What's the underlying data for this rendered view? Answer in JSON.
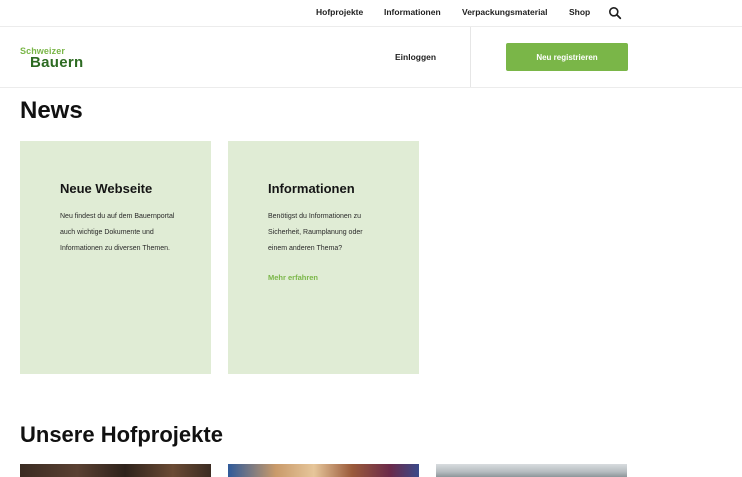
{
  "topnav": {
    "links": [
      "Hofprojekte",
      "Informationen",
      "Verpackungsmaterial",
      "Shop"
    ],
    "search_icon": "search-icon"
  },
  "header": {
    "logo_line1": "Schweizer",
    "logo_line2": "Bauern",
    "login_label": "Einloggen",
    "register_label": "Neu registrieren"
  },
  "news": {
    "heading": "News",
    "cards": [
      {
        "title": "Neue Webseite",
        "body": "Neu findest du auf dem Bauernportal auch wichtige Dokumente und Informationen zu diversen Themen.",
        "link": ""
      },
      {
        "title": "Informationen",
        "body": "Benötigst du Informationen zu Sicherheit, Raumplanung oder einem anderen Thema?",
        "link": "Mehr erfahren"
      }
    ]
  },
  "projects": {
    "heading": "Unsere Hofprojekte"
  },
  "colors": {
    "brand_green": "#7ab648",
    "dark_green": "#2d6b22",
    "card_bg": "#e0ecd5"
  }
}
